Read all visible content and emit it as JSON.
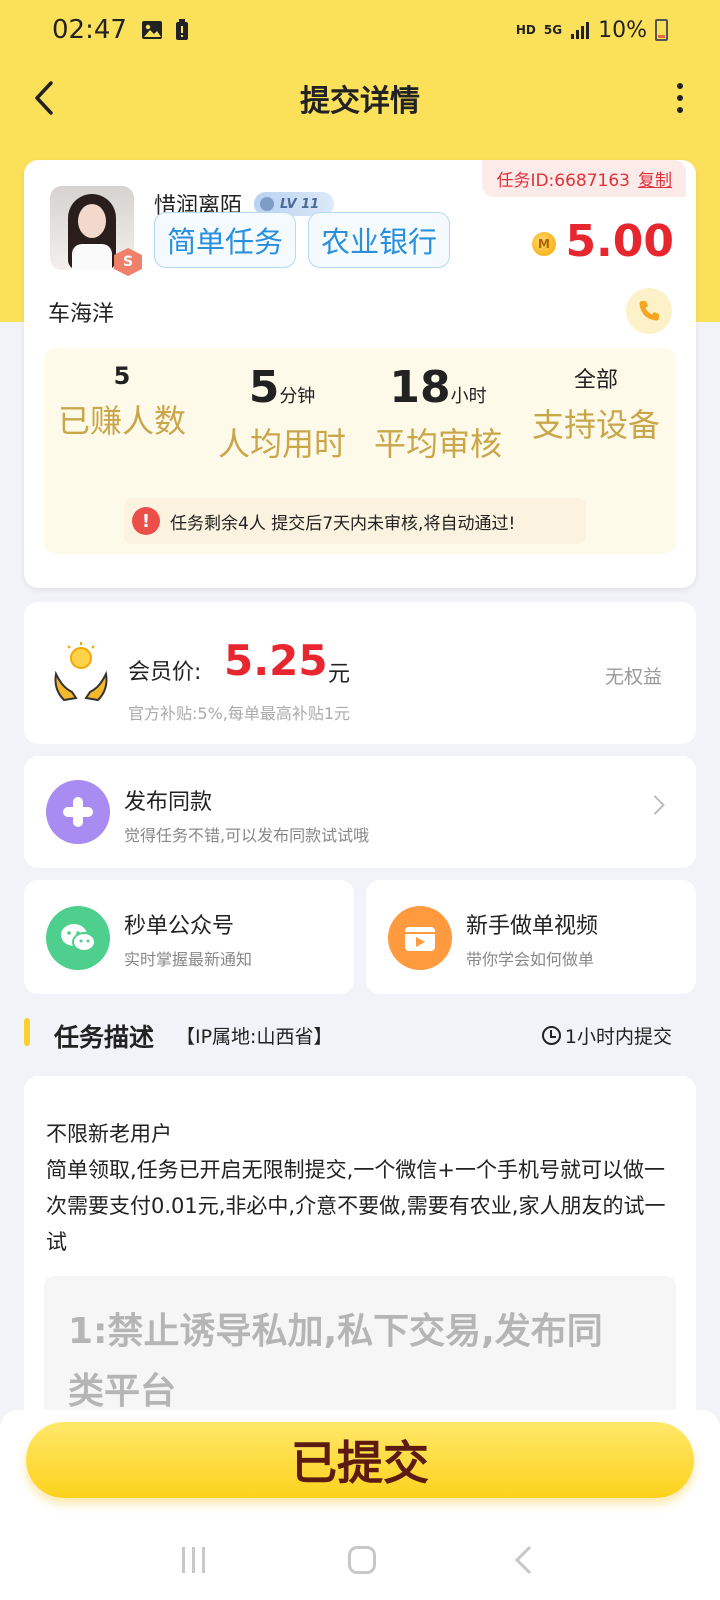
{
  "status_bar": {
    "time": "02:47",
    "hd": "HD",
    "net": "5G",
    "battery": "10%"
  },
  "nav": {
    "title": "提交详情"
  },
  "task": {
    "id_label": "任务ID:6687163",
    "copy_label": "复制",
    "user_name": "惜润离陌",
    "level": "LV 11",
    "avatar_badge": "S",
    "tags": [
      "简单任务",
      "农业银行"
    ],
    "coin_symbol": "M",
    "price": "5.00",
    "owner": "车海洋"
  },
  "stats": {
    "earned_value": "5",
    "earned_label": "已赚人数",
    "avg_time_value": "5",
    "avg_time_unit": "分钟",
    "avg_time_label": "人均用时",
    "review_value": "18",
    "review_unit": "小时",
    "review_label": "平均审核",
    "device_value": "全部",
    "device_label": "支持设备",
    "notice": "任务剩余4人 提交后7天内未审核,将自动通过!"
  },
  "member": {
    "label": "会员价:",
    "price": "5.25",
    "unit": "元",
    "sub": "官方补贴:5%,每单最高补贴1元",
    "rights": "无权益"
  },
  "publish": {
    "title": "发布同款",
    "sub": "觉得任务不错,可以发布同款试试哦"
  },
  "quick_links": [
    {
      "title": "秒单公众号",
      "sub": "实时掌握最新通知"
    },
    {
      "title": "新手做单视频",
      "sub": "带你学会如何做单"
    }
  ],
  "section": {
    "title": "任务描述",
    "ip": "【IP属地:山西省】",
    "time": "1小时内提交"
  },
  "description": {
    "lines": [
      "不限新老用户",
      "简单领取,任务已开启无限制提交,一个微信+一个手机号就可以做一次需要支付0.01元,非必中,介意不要做,需要有农业,家人朋友的试一试"
    ],
    "rule": "1:禁止诱导私加,私下交易,发布同类平台"
  },
  "bottom": {
    "submit_label": "已提交"
  },
  "colors": {
    "accent": "#fbe15a",
    "price": "#e7262f",
    "gold_label": "#c9a64a",
    "tag_blue": "#2a8fdc"
  }
}
